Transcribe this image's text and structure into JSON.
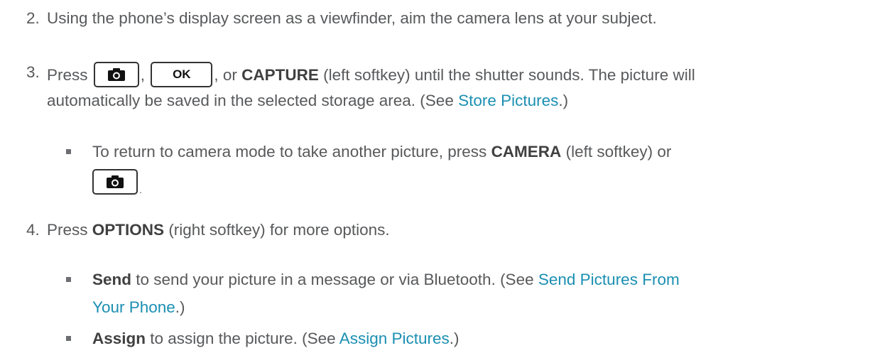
{
  "steps": {
    "step2": {
      "num": "2.",
      "text": "Using the phone’s display screen as a viewfinder, aim the camera lens at your subject."
    },
    "step3": {
      "num": "3.",
      "press": "Press",
      "sep1": ",",
      "ok_key_label": "OK",
      "sep2": ", or",
      "capture_bold": "CAPTURE",
      "after_capture": "(left softkey) until the shutter sounds. The picture will",
      "line2_text": "automatically be saved in the selected storage area. (See",
      "line2_link": "Store Pictures",
      "line2_end": ".)",
      "bullet": {
        "pre": "To return to camera mode to take another picture, press",
        "bold": "CAMERA",
        "post": "(left softkey) or",
        "end": "."
      }
    },
    "step4": {
      "num": "4.",
      "press": "Press",
      "options_bold": "OPTIONS",
      "rest": "(right softkey) for more options.",
      "bullet_send": {
        "bold": "Send",
        "text": "to send your picture in a message or via Bluetooth. (See",
        "link_part1": "Send Pictures From",
        "link_part2": "Your Phone",
        "end": ".)"
      },
      "bullet_assign": {
        "bold": "Assign",
        "text": "to assign the picture. (See",
        "link": "Assign Pictures",
        "end": ".)"
      }
    }
  },
  "icons": {
    "camera_key": "camera-icon"
  },
  "colors": {
    "text": "#58595b",
    "bold": "#404040",
    "link": "#1b8fb2",
    "bullet": "#6d6e71"
  }
}
